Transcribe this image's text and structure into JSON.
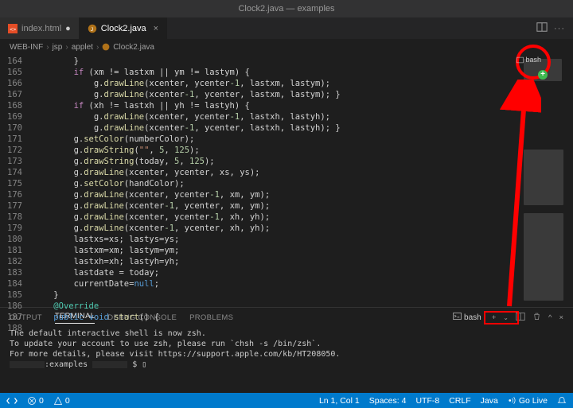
{
  "titlebar": {
    "title": "Clock2.java — examples"
  },
  "tabs": [
    {
      "icon": "html-file-icon",
      "label": "index.html",
      "active": false,
      "dirty": true
    },
    {
      "icon": "java-file-icon",
      "label": "Clock2.java",
      "active": true,
      "dirty": false
    }
  ],
  "breadcrumb": [
    "WEB-INF",
    "jsp",
    "applet",
    "Clock2.java"
  ],
  "gutter_start": 164,
  "gutter_end": 188,
  "code_lines": [
    {
      "i": 0,
      "html": "        }"
    },
    {
      "i": 1,
      "html": "        <span class='kw2'>if</span> (xm != lastxm || ym != lastym) {"
    },
    {
      "i": 2,
      "html": "            g.<span class='fn'>drawLine</span>(xcenter, ycenter<span class='num'>-1</span>, lastxm, lastym);"
    },
    {
      "i": 3,
      "html": "            g.<span class='fn'>drawLine</span>(xcenter<span class='num'>-1</span>, ycenter, lastxm, lastym); }"
    },
    {
      "i": 4,
      "html": "        <span class='kw2'>if</span> (xh != lastxh || yh != lastyh) {"
    },
    {
      "i": 5,
      "html": "            g.<span class='fn'>drawLine</span>(xcenter, ycenter<span class='num'>-1</span>, lastxh, lastyh);"
    },
    {
      "i": 6,
      "html": "            g.<span class='fn'>drawLine</span>(xcenter<span class='num'>-1</span>, ycenter, lastxh, lastyh); }"
    },
    {
      "i": 7,
      "html": "        g.<span class='fn'>setColor</span>(numberColor);"
    },
    {
      "i": 8,
      "html": "        g.<span class='fn'>drawString</span>(<span class='str'>\"\"</span>, <span class='num'>5</span>, <span class='num'>125</span>);"
    },
    {
      "i": 9,
      "html": "        g.<span class='fn'>drawString</span>(today, <span class='num'>5</span>, <span class='num'>125</span>);"
    },
    {
      "i": 10,
      "html": "        g.<span class='fn'>drawLine</span>(xcenter, ycenter, xs, ys);"
    },
    {
      "i": 11,
      "html": "        g.<span class='fn'>setColor</span>(handColor);"
    },
    {
      "i": 12,
      "html": "        g.<span class='fn'>drawLine</span>(xcenter, ycenter<span class='num'>-1</span>, xm, ym);"
    },
    {
      "i": 13,
      "html": "        g.<span class='fn'>drawLine</span>(xcenter<span class='num'>-1</span>, ycenter, xm, ym);"
    },
    {
      "i": 14,
      "html": "        g.<span class='fn'>drawLine</span>(xcenter, ycenter<span class='num'>-1</span>, xh, yh);"
    },
    {
      "i": 15,
      "html": "        g.<span class='fn'>drawLine</span>(xcenter<span class='num'>-1</span>, ycenter, xh, yh);"
    },
    {
      "i": 16,
      "html": "        lastxs=xs; lastys=ys;"
    },
    {
      "i": 17,
      "html": "        lastxm=xm; lastym=ym;"
    },
    {
      "i": 18,
      "html": "        lastxh=xh; lastyh=yh;"
    },
    {
      "i": 19,
      "html": "        lastdate = today;"
    },
    {
      "i": 20,
      "html": "        currentDate=<span class='kw'>null</span>;"
    },
    {
      "i": 21,
      "html": "    }"
    },
    {
      "i": 22,
      "html": ""
    },
    {
      "i": 23,
      "html": "    <span class='ann'>@Override</span>"
    },
    {
      "i": 24,
      "html": "    <span class='kw'>public</span> <span class='kw'>void</span> <span class='fn'>start</span>() {"
    }
  ],
  "panel": {
    "tabs": {
      "output": "OUTPUT",
      "terminal": "TERMINAL",
      "debug": "DEBUG CONSOLE",
      "problems": "PROBLEMS"
    },
    "shell_label": "bash",
    "body": {
      "l1": "The default interactive shell is now zsh.",
      "l2": "To update your account to use zsh, please run `chsh -s /bin/zsh`.",
      "l3": "For more details, please visit https://support.apple.com/kb/HT208050.",
      "prompt_mid": ":examples",
      "prompt_end": "$ ▯"
    }
  },
  "status": {
    "errors": "0",
    "warnings": "0",
    "lncol": "Ln 1, Col 1",
    "spaces": "Spaces: 4",
    "encoding": "UTF-8",
    "eol": "CRLF",
    "lang": "Java",
    "golive": "Go Live",
    "bell": "notification-icon"
  },
  "annotations": {
    "circle_label": "bash"
  }
}
